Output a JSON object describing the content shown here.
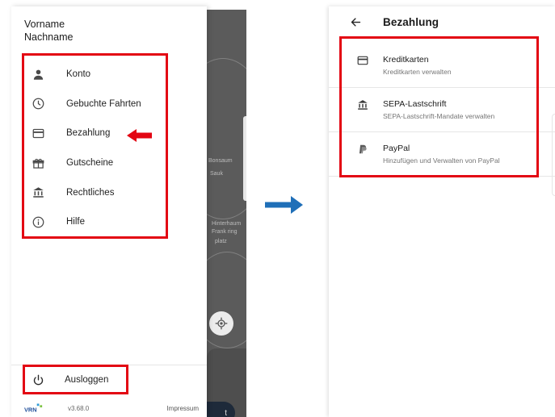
{
  "drawer": {
    "user_first": "Vorname",
    "user_last": "Nachname",
    "menu": [
      {
        "label": "Konto",
        "icon": "person-icon"
      },
      {
        "label": "Gebuchte Fahrten",
        "icon": "clock-icon"
      },
      {
        "label": "Bezahlung",
        "icon": "credit-card-icon"
      },
      {
        "label": "Gutscheine",
        "icon": "gift-icon"
      },
      {
        "label": "Rechtliches",
        "icon": "bank-icon"
      },
      {
        "label": "Hilfe",
        "icon": "info-icon"
      }
    ],
    "logout_label": "Ausloggen",
    "version": "v3.68.0",
    "impressum": "Impressum"
  },
  "map": {
    "labels": [
      "Bonsaum",
      "Sauk",
      "Hinterhaum",
      "Frank ring",
      "platz"
    ],
    "cta_label": "t"
  },
  "payment_screen": {
    "title": "Bezahlung",
    "items": [
      {
        "title": "Kreditkarten",
        "subtitle": "Kreditkarten verwalten",
        "icon": "credit-card-icon"
      },
      {
        "title": "SEPA-Lastschrift",
        "subtitle": "SEPA-Lastschrift-Mandate verwalten",
        "icon": "bank-icon"
      },
      {
        "title": "PayPal",
        "subtitle": "Hinzufügen und Verwalten von PayPal",
        "icon": "paypal-icon"
      }
    ]
  },
  "colors": {
    "highlight": "#e30613",
    "transition_arrow": "#1f6fb8",
    "map": "#5b5b5b"
  }
}
